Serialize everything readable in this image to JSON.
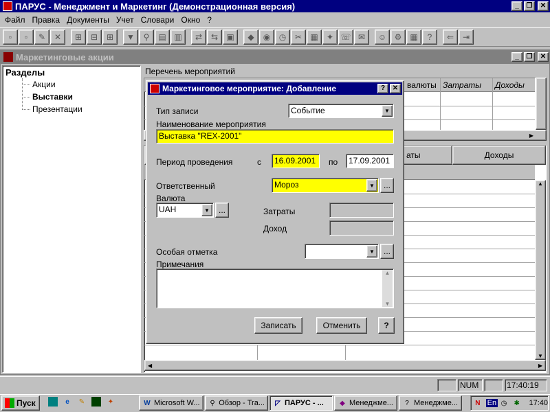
{
  "app": {
    "title": "ПАРУС - Менеджмент и Маркетинг (Демонстрационная версия)",
    "menu": [
      "Файл",
      "Правка",
      "Документы",
      "Учет",
      "Словари",
      "Окно",
      "?"
    ]
  },
  "child_window": {
    "title": "Маркетинговые акции",
    "tree": {
      "root": "Разделы",
      "items": [
        "Акции",
        "Выставки",
        "Презентации"
      ],
      "selected": "Выставки"
    },
    "list_title": "Перечень мероприятий",
    "upper_columns": [
      "валюты",
      "Затраты",
      "Доходы"
    ],
    "lower_columns": [
      "аты",
      "Доходы"
    ]
  },
  "dialog": {
    "title": "Маркетинговое мероприятие: Добавление",
    "record_type_label": "Тип записи",
    "record_type_value": "Событие",
    "name_label": "Наименование мероприятия",
    "name_value": "Выставка \"REX-2001\"",
    "period_label": "Период проведения",
    "from_label": "с",
    "from_value": "16.09.2001",
    "to_label": "по",
    "to_value": "17.09.2001",
    "responsible_label": "Ответственный",
    "responsible_value": "Мороз",
    "currency_label": "Валюта",
    "currency_value": "UAH",
    "costs_label": "Затраты",
    "income_label": "Доход",
    "special_mark_label": "Особая отметка",
    "notes_label": "Примечания",
    "save_button": "Записать",
    "cancel_button": "Отменить",
    "help_button": "?",
    "ellipsis": "..."
  },
  "statusbar": {
    "num": "NUM",
    "time": "17:40:19"
  },
  "taskbar": {
    "start": "Пуск",
    "tasks": [
      "Microsoft W...",
      "Обзор - Tra...",
      "ПАРУС - ...",
      "Менеджме...",
      "Менеджме..."
    ],
    "lang": "En",
    "clock": "17:40"
  }
}
